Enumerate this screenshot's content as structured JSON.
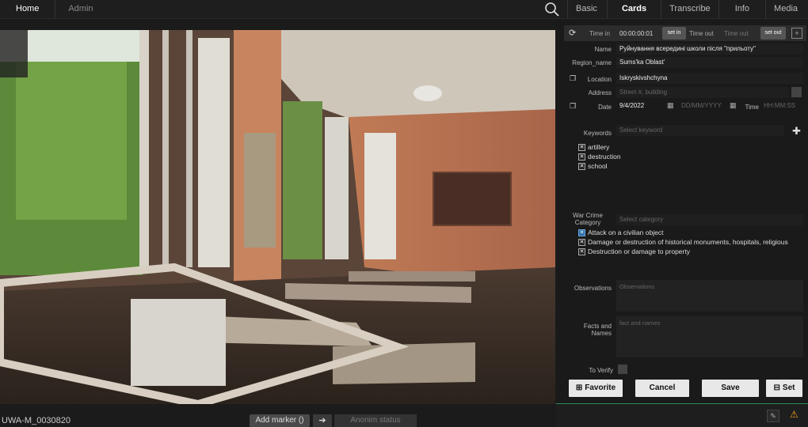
{
  "nav": {
    "home": "Home",
    "admin": "Admin"
  },
  "tabs": [
    "Basic Info",
    "Cards",
    "Transcribe",
    "Info",
    "Media Sets"
  ],
  "time": {
    "time_in_label": "Time in",
    "time_in_value": "00:00:00:01",
    "set_in": "set in",
    "time_out_label": "Time out",
    "time_out_placeholder": "Time out",
    "set_out": "set out"
  },
  "fields": {
    "name_label": "Name",
    "name_value": "Руйнування всередині школи після \"прильоту\"",
    "region_label": "Region_name",
    "region_value": "Sums'ka Oblast'",
    "location_label": "Location",
    "location_value": "Iskryskivshchyna",
    "address_label": "Address",
    "address_placeholder": "Street #, building",
    "date_label": "Date",
    "date_value": "9/4/2022",
    "date_placeholder": "DD/MM/YYYY",
    "time_label": "Time",
    "time_placeholder": "HH:MM:SS",
    "keywords_label": "Keywords",
    "keywords_placeholder": "Select keyword",
    "war_crime_label": "War Crime Category",
    "war_crime_placeholder": "Select category",
    "observations_label": "Observations",
    "observations_placeholder": "Observations",
    "facts_label": "Facts and Names",
    "facts_placeholder": "fact and names",
    "verify_label": "To Verify"
  },
  "keywords": [
    "artillery",
    "destruction",
    "school"
  ],
  "categories": [
    {
      "label": "Attack on a civilian object",
      "highlighted": true
    },
    {
      "label": "Damage or destruction of historical monuments, hospitals, religious",
      "highlighted": false
    },
    {
      "label": "Destruction or damage to property",
      "highlighted": false
    }
  ],
  "buttons": {
    "favorite": "Favorite",
    "cancel": "Cancel",
    "save": "Save",
    "set": "Set"
  },
  "bottom": {
    "filename": "UWA-M_0030820",
    "add_marker": "Add marker ()",
    "anonim": "Anonim status"
  },
  "colors": {
    "accent": "#2e8b57",
    "warning": "#f0a020"
  }
}
